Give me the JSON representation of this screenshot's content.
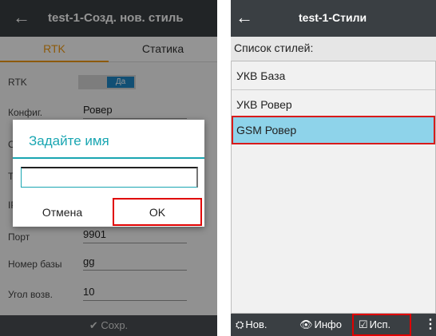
{
  "left": {
    "title": "test-1-Созд. нов. стиль",
    "back_icon": "arrow-left-icon",
    "tabs": [
      "RTK",
      "Статика"
    ],
    "rows": [
      {
        "label": "RTK",
        "value": "Да"
      },
      {
        "label": "Конфиг.",
        "value": "Ровер"
      },
      {
        "label": "Со",
        "value": ""
      },
      {
        "label": "Ти",
        "value": ""
      },
      {
        "label": "IP",
        "value": ""
      },
      {
        "label": "Порт",
        "value": "9901"
      },
      {
        "label": "Номер базы",
        "value": "gg"
      },
      {
        "label": "Угол возв.",
        "value": "10"
      }
    ],
    "save": "Сохр.",
    "save_icon": "checkmark-icon",
    "dialog": {
      "title": "Задайте имя",
      "input_value": "",
      "cancel": "Отмена",
      "ok": "OK"
    }
  },
  "right": {
    "title": "test-1-Стили",
    "back_icon": "arrow-left-icon",
    "list_header": "Список стилей:",
    "items": [
      "УКВ База",
      "УКВ Ровер",
      "GSM Ровер"
    ],
    "selected_index": 2,
    "buttons": {
      "new": "Нов.",
      "info": "Инфо",
      "use": "Исп."
    }
  },
  "colors": {
    "accent_teal": "#1aa6b2",
    "tab_orange": "#f39c12",
    "highlight_red": "#e00000",
    "selection_blue": "#8ed3ea"
  }
}
